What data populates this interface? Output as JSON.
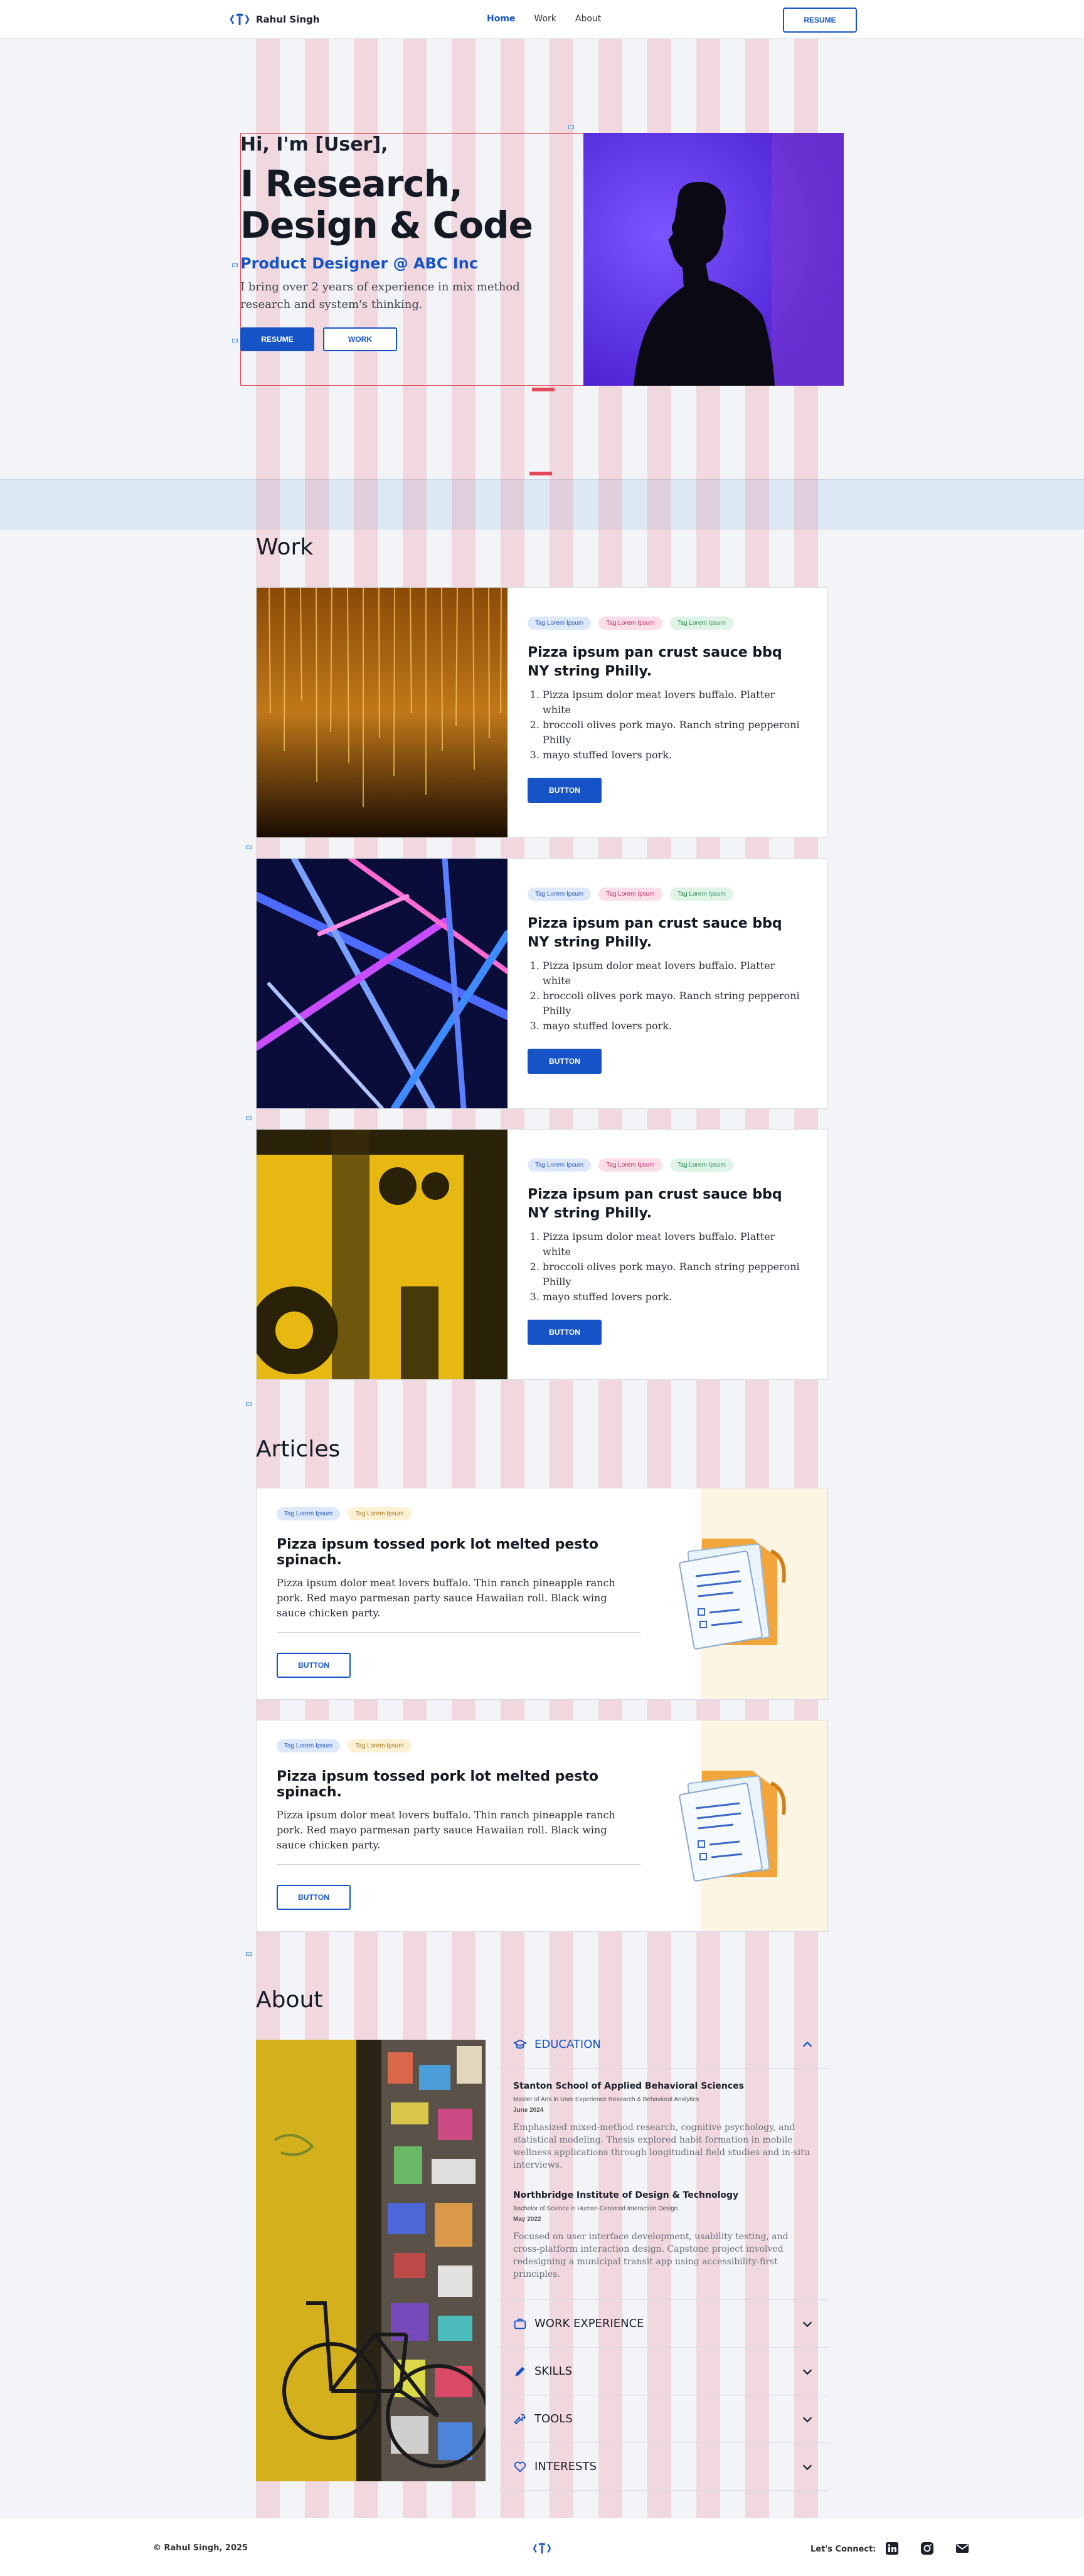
{
  "header": {
    "brand": "Rahul Singh",
    "nav": [
      "Home",
      "Work",
      "About"
    ],
    "resume": "RESUME"
  },
  "hero": {
    "greeting": "Hi, I'm [User],",
    "title": "I Research, Design & Code",
    "role": "Product Designer @ ABC Inc",
    "description": "I bring over 2 years of experience in mix method research and system's thinking.",
    "resume_button": "RESUME",
    "work_button": "WORK"
  },
  "work": {
    "title": "Work",
    "tags": [
      "Tag Lorem Ipsum",
      "Tag Lorem Ipsum",
      "Tag Lorem Ipsum"
    ],
    "cards": [
      {
        "title": "Pizza ipsum pan crust sauce bbq NY string Philly.",
        "items": [
          "Pizza ipsum dolor meat lovers buffalo. Platter white",
          "broccoli olives pork mayo. Ranch string pepperoni Philly",
          "mayo stuffed lovers pork."
        ],
        "button": "BUTTON"
      },
      {
        "title": "Pizza ipsum pan crust sauce bbq NY string Philly.",
        "items": [
          "Pizza ipsum dolor meat lovers buffalo. Platter white",
          "broccoli olives pork mayo. Ranch string pepperoni Philly",
          "mayo stuffed lovers pork."
        ],
        "button": "BUTTON"
      },
      {
        "title": "Pizza ipsum pan crust sauce bbq NY string Philly.",
        "items": [
          "Pizza ipsum dolor meat lovers buffalo. Platter white",
          "broccoli olives pork mayo. Ranch string pepperoni Philly",
          "mayo stuffed lovers pork."
        ],
        "button": "BUTTON"
      }
    ]
  },
  "articles": {
    "title": "Articles",
    "tags": [
      "Tag Lorem Ipsum",
      "Tag Lorem Ipsum"
    ],
    "cards": [
      {
        "title": "Pizza ipsum tossed pork lot melted pesto spinach.",
        "description": "Pizza ipsum dolor meat lovers buffalo. Thin ranch pineapple ranch pork. Red mayo parmesan party sauce Hawaiian roll. Black wing sauce chicken party.",
        "button": "BUTTON"
      },
      {
        "title": "Pizza ipsum tossed pork lot melted pesto spinach.",
        "description": "Pizza ipsum dolor meat lovers buffalo. Thin ranch pineapple ranch pork. Red mayo parmesan party sauce Hawaiian roll. Black wing sauce chicken party.",
        "button": "BUTTON"
      }
    ]
  },
  "about": {
    "title": "About",
    "sections": {
      "education": "EDUCATION",
      "work_experience": "WORK EXPERIENCE",
      "skills": "SKILLS",
      "tools": "TOOLS",
      "interests": "INTERESTS"
    },
    "education": [
      {
        "school": "Stanton School of Applied Behavioral Sciences",
        "degree": "Master of Arts in User Experience Research & Behavioral Analytics",
        "date": "June 2024",
        "description": "Emphasized mixed-method research, cognitive psychology, and statistical modeling. Thesis explored habit formation in mobile wellness applications through longitudinal field studies and in-situ interviews."
      },
      {
        "school": "Northbridge Institute of Design & Technology",
        "degree": "Bachelor of Science in Human-Centered Interaction Design",
        "date": "May 2022",
        "description": "Focused on user interface development, usability testing, and cross-platform interaction design. Capstone project involved redesigning a municipal transit app using accessibility-first principles."
      }
    ]
  },
  "footer": {
    "copyright": "© Rahul Singh, 2025",
    "connect": "Let's Connect:"
  },
  "colors": {
    "accent": "#1553c6",
    "grid_overlay": "#ec788c"
  }
}
